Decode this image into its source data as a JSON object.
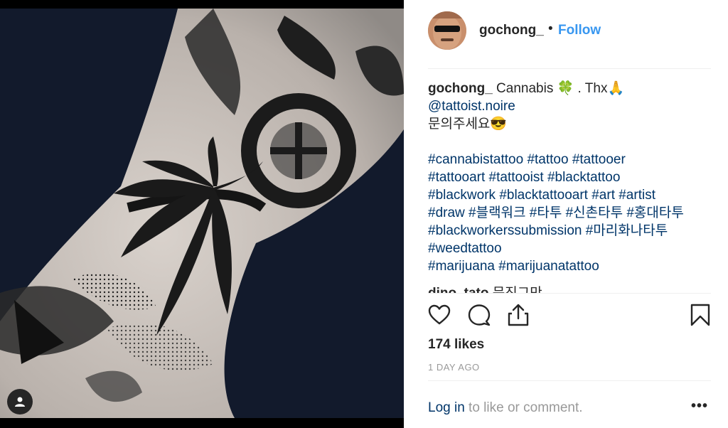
{
  "post": {
    "username": "gochong_",
    "separator": "•",
    "follow_label": "Follow"
  },
  "caption": {
    "username": "gochong_",
    "line1_text": " Cannabis 🍀  . Thx🙏",
    "mention": "@tattoist.noire",
    "korean_line": "문의주세요😎",
    "hashtag_lines": [
      "#cannabistattoo #tattoo #tattooer",
      "#tattooart #tattooist #blacktattoo",
      "#blackwork #blacktattooart #art #artist",
      "#draw #블랙워크 #타투 #신촌타투 #홍대타투",
      "#blackworkerssubmission #마리화나타투",
      "#weedtattoo",
      "#marijuana #marijuanatattoo"
    ]
  },
  "next_comment": {
    "username": "dino_tato",
    "text": " 문진그만"
  },
  "icons": {
    "like": "heart-icon",
    "comment": "comment-icon",
    "share": "share-icon",
    "save": "bookmark-icon",
    "tag": "user-tag-icon"
  },
  "likes": "174 likes",
  "timestamp": "1 DAY AGO",
  "login": {
    "link_label": "Log in",
    "rest": " to like or comment."
  },
  "more_label": "•••",
  "colors": {
    "accent": "#3897f0",
    "hashtag": "#003569",
    "text": "#262626",
    "muted": "#999999",
    "photo_bg": "#121a2c"
  }
}
